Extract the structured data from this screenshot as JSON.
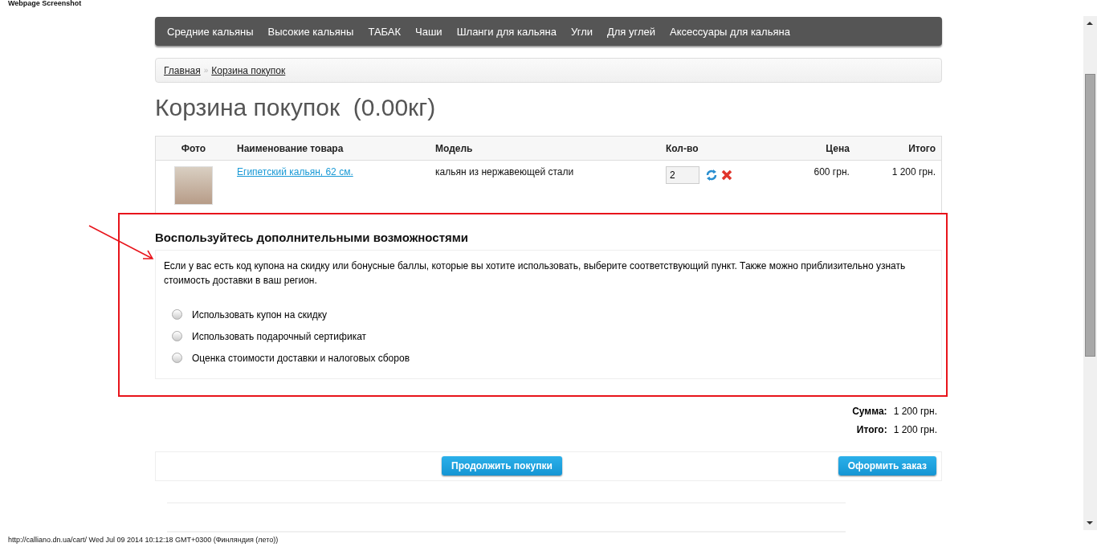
{
  "capture_title": "Webpage Screenshot",
  "nav": [
    "Средние кальяны",
    "Высокие кальяны",
    "ТАБАК",
    "Чаши",
    "Шланги для кальяна",
    "Угли",
    "Для углей",
    "Аксессуары для кальяна"
  ],
  "breadcrumb": [
    {
      "label": "Главная"
    },
    {
      "label": "Корзина покупок",
      "separator": "»"
    }
  ],
  "heading": "Корзина покупок  (0.00кг)",
  "table": {
    "columns": [
      "Фото",
      "Наименование товара",
      "Модель",
      "Кол-во",
      "Цена",
      "Итого"
    ],
    "rows": [
      {
        "name": "Египетский кальян, 62 см.",
        "model": "кальян из нержавеющей стали",
        "quantity": "2",
        "price": "600 грн.",
        "total": "1 200 грн."
      }
    ]
  },
  "options": {
    "title": "Воспользуйтесь дополнительными возможностями",
    "description": "Если у вас есть код купона на скидку или бонусные баллы, которые вы хотите использовать, выберите соответствующий пункт. Также можно приблизительно узнать стоимость доставки в ваш регион.",
    "choices": [
      {
        "label": "Использовать купон на скидку",
        "selected": false
      },
      {
        "label": "Использовать подарочный сертификат",
        "selected": false
      },
      {
        "label": "Оценка стоимости доставки и налоговых сборов",
        "selected": false
      }
    ]
  },
  "totals": [
    {
      "label": "Сумма:",
      "value": "1 200 грн."
    },
    {
      "label": "Итого:",
      "value": "1 200 грн."
    }
  ],
  "buttons": [
    "Продолжить покупки",
    "Оформить заказ"
  ],
  "status_bar": "http://calliano.dn.ua/cart/ Wed Jul 09 2014 10:12:18 GMT+0300 (Финляндия (лето))"
}
